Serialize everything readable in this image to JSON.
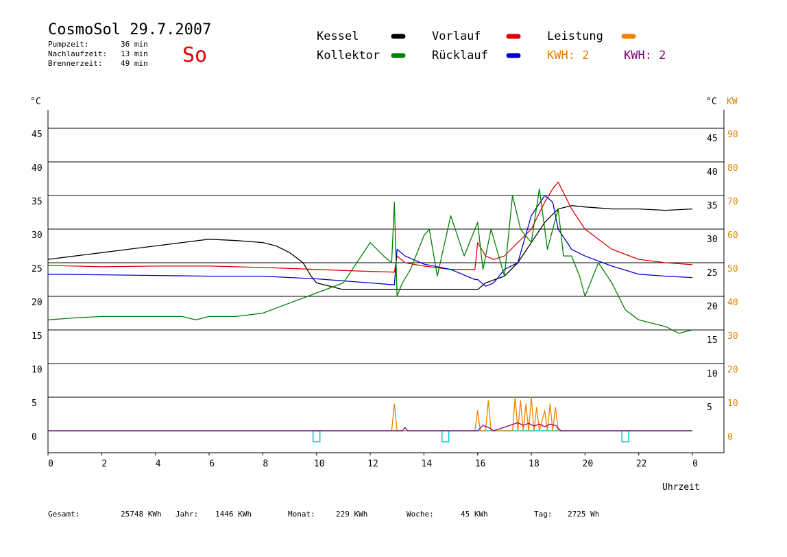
{
  "header": {
    "title": "CosmoSol 29.7.2007",
    "day": "So",
    "info": [
      {
        "label": "Pumpzeit:",
        "value": "36 min"
      },
      {
        "label": "Nachlaufzeit:",
        "value": "13 min"
      },
      {
        "label": "Brennerzeit:",
        "value": "49 min"
      }
    ]
  },
  "legend": [
    {
      "label": "Kessel",
      "color": "#000000"
    },
    {
      "label": "Kollektor",
      "color": "#008000"
    },
    {
      "label": "Vorlauf",
      "color": "#e00000"
    },
    {
      "label": "Rücklauf",
      "color": "#0000cc"
    },
    {
      "label": "Leistung",
      "color": "#f08000"
    }
  ],
  "kwh": [
    {
      "label": "KWH: 2",
      "color": "#e08000"
    },
    {
      "label": "KWH: 2",
      "color": "#800080"
    }
  ],
  "footer": [
    {
      "label": "Gesamt:",
      "value": "25748 KWh"
    },
    {
      "label": "Jahr:",
      "value": "1446 KWh"
    },
    {
      "label": "Monat:",
      "value": "229 KWh"
    },
    {
      "label": "Woche:",
      "value": "45 KWh"
    },
    {
      "label": "Tag:",
      "value": "2725 Wh"
    }
  ],
  "colors": {
    "grid": "#000000",
    "kw_axis": "#e08000",
    "baseline": "#00c8d8"
  },
  "chart_data": {
    "type": "line",
    "xlabel": "Uhrzeit",
    "x_ticks": [
      "0",
      "2",
      "4",
      "6",
      "8",
      "10",
      "12",
      "14",
      "16",
      "18",
      "20",
      "22",
      "0"
    ],
    "x_range": [
      0,
      24
    ],
    "y_left_label": "°C",
    "y_left_ticks_left": [
      "0",
      "5",
      "10",
      "15",
      "20",
      "25",
      "30",
      "35",
      "40",
      "45"
    ],
    "y_left_ticks_right": [
      "5",
      "10",
      "15",
      "20",
      "25",
      "30",
      "35",
      "40",
      "45"
    ],
    "y_right_label": "KW",
    "y_right_ticks": [
      "0",
      "10",
      "20",
      "30",
      "40",
      "50",
      "60",
      "70",
      "80",
      "90"
    ],
    "ylim": [
      0,
      45
    ],
    "grid": true,
    "series": [
      {
        "name": "Kessel",
        "color": "#000000",
        "x": [
          0,
          1,
          2,
          3,
          4,
          5,
          6,
          7,
          8,
          8.5,
          9,
          9.5,
          9.8,
          10,
          10.5,
          11,
          12,
          12.9,
          13,
          14,
          15,
          16,
          16.3,
          17,
          17.5,
          18,
          18.5,
          19,
          19.5,
          20,
          21,
          22,
          23,
          24
        ],
        "y": [
          25.5,
          26,
          26.5,
          27,
          27.5,
          28,
          28.5,
          28.3,
          28,
          27.5,
          26.5,
          25,
          23,
          22,
          21.5,
          21,
          21,
          21,
          21,
          21,
          21,
          21,
          22,
          23,
          25,
          28,
          31,
          33,
          33.5,
          33.3,
          33,
          33,
          32.8,
          33
        ]
      },
      {
        "name": "Vorlauf",
        "color": "#e00000",
        "x": [
          0,
          2,
          4,
          6,
          8,
          10,
          12,
          12.9,
          13,
          13.3,
          14,
          15,
          15.9,
          16,
          16.3,
          16.6,
          17,
          17.5,
          18,
          18.5,
          18.8,
          19,
          19.5,
          20,
          21,
          22,
          23,
          24
        ],
        "y": [
          24.6,
          24.4,
          24.5,
          24.5,
          24.3,
          24,
          23.7,
          23.6,
          26,
          25,
          24.5,
          24,
          24,
          28,
          26,
          25.5,
          26,
          28,
          30,
          34,
          36,
          37,
          33,
          30,
          27,
          25.5,
          25,
          24.7
        ]
      },
      {
        "name": "Rücklauf",
        "color": "#0000cc",
        "x": [
          0,
          2,
          4,
          6,
          8,
          10,
          12,
          12.9,
          13,
          13.3,
          14,
          15,
          15.9,
          16,
          16.3,
          16.6,
          17,
          17.5,
          18,
          18.5,
          18.8,
          19,
          19.5,
          20,
          21,
          22,
          23,
          24
        ],
        "y": [
          23.3,
          23.2,
          23.1,
          23,
          23,
          22.6,
          22,
          21.7,
          27,
          26,
          24.8,
          24,
          22.5,
          22.5,
          21.5,
          22,
          24,
          25,
          32,
          35,
          34,
          30,
          27,
          26,
          24.5,
          23.3,
          23,
          22.8
        ]
      },
      {
        "name": "Kollektor",
        "color": "#008000",
        "x": [
          0,
          1,
          2,
          3,
          4,
          5,
          5.5,
          6,
          7,
          8,
          9,
          10,
          11,
          11.5,
          12,
          12.5,
          12.8,
          12.9,
          13,
          13.2,
          13.5,
          14,
          14.2,
          14.5,
          15,
          15.5,
          16,
          16.2,
          16.5,
          17,
          17.3,
          17.6,
          18,
          18.3,
          18.6,
          19,
          19.2,
          19.5,
          19.8,
          20,
          20.2,
          20.5,
          21,
          21.5,
          22,
          23,
          23.5,
          24
        ],
        "y": [
          16.5,
          16.8,
          17,
          17,
          17,
          17,
          16.5,
          17,
          17,
          17.5,
          19,
          20.5,
          22,
          25,
          28,
          26,
          25,
          34,
          20,
          22,
          24,
          29,
          30,
          23,
          32,
          26,
          31,
          24,
          30,
          23,
          35,
          30,
          28,
          36,
          27,
          33,
          26,
          26,
          23,
          20,
          22,
          25,
          22,
          18,
          16.5,
          15.5,
          14.5,
          15
        ]
      },
      {
        "name": "Leistung",
        "color": "#f08000",
        "x": [
          0,
          12.8,
          12.9,
          13,
          13.1,
          15.9,
          16,
          16.1,
          16.3,
          16.4,
          16.5,
          17.3,
          17.4,
          17.5,
          17.6,
          17.7,
          17.8,
          17.9,
          18,
          18.1,
          18.2,
          18.3,
          18.5,
          18.6,
          18.7,
          18.8,
          18.9,
          19,
          19.1,
          24
        ],
        "y": [
          0,
          0,
          4,
          0,
          0,
          0,
          3,
          0,
          0,
          4.5,
          0,
          0,
          5,
          0,
          4.5,
          0,
          4,
          0,
          5,
          0,
          3.5,
          0,
          3,
          0,
          4,
          0,
          3.5,
          0,
          0,
          0
        ]
      },
      {
        "name": "KWH",
        "color": "#800080",
        "x": [
          0,
          13.2,
          13.3,
          13.4,
          16,
          16.2,
          16.4,
          16.6,
          17.5,
          17.7,
          17.9,
          18.1,
          18.3,
          18.5,
          18.7,
          18.9,
          19.1,
          24
        ],
        "y": [
          0,
          0,
          0.5,
          0,
          0,
          0.8,
          0.5,
          0,
          1.2,
          0.8,
          1.1,
          0.7,
          1.0,
          0.6,
          1.0,
          0.8,
          0,
          0
        ]
      }
    ]
  }
}
